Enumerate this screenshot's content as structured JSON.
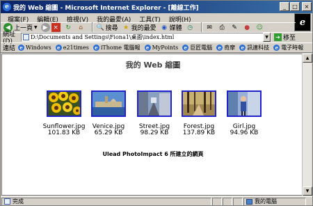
{
  "window": {
    "title": "我的 Web 縮圖 - Microsoft Internet Explorer - [離線工作]",
    "btn_min": "_",
    "btn_max": "□",
    "btn_close": "×"
  },
  "menu": {
    "items": [
      "檔案(F)",
      "編輯(E)",
      "檢視(V)",
      "我的最愛(A)",
      "工具(T)",
      "說明(H)"
    ]
  },
  "toolbar": {
    "back_label": "上一頁",
    "search_label": "搜尋",
    "favorites_label": "我的最愛",
    "media_label": "媒體"
  },
  "address": {
    "label": "網址(D)",
    "value": "D:\\Documents and Settings\\Fiona1\\桌面\\index.html",
    "go_label": "移至"
  },
  "links": {
    "label": "連結",
    "items": [
      "Windows",
      "e21times",
      "iThome 電腦報",
      "MyPoints",
      "巨匠電腦",
      "奇摩",
      "訊連科技",
      "電子時報"
    ]
  },
  "page": {
    "title": "我的 Web 縮圖",
    "footer": "Ulead PhotoImpact 6 所建立的網頁",
    "thumbs": [
      {
        "name": "Sunflower.jpg",
        "size": "101.83 KB"
      },
      {
        "name": "Venice.jpg",
        "size": "65.29 KB"
      },
      {
        "name": "Street.jpg",
        "size": "98.29 KB"
      },
      {
        "name": "Forest.jpg",
        "size": "137.89 KB"
      },
      {
        "name": "Girl.jpg",
        "size": "94.96 KB"
      }
    ]
  },
  "status": {
    "text": "完成",
    "zone": "我的電腦"
  }
}
